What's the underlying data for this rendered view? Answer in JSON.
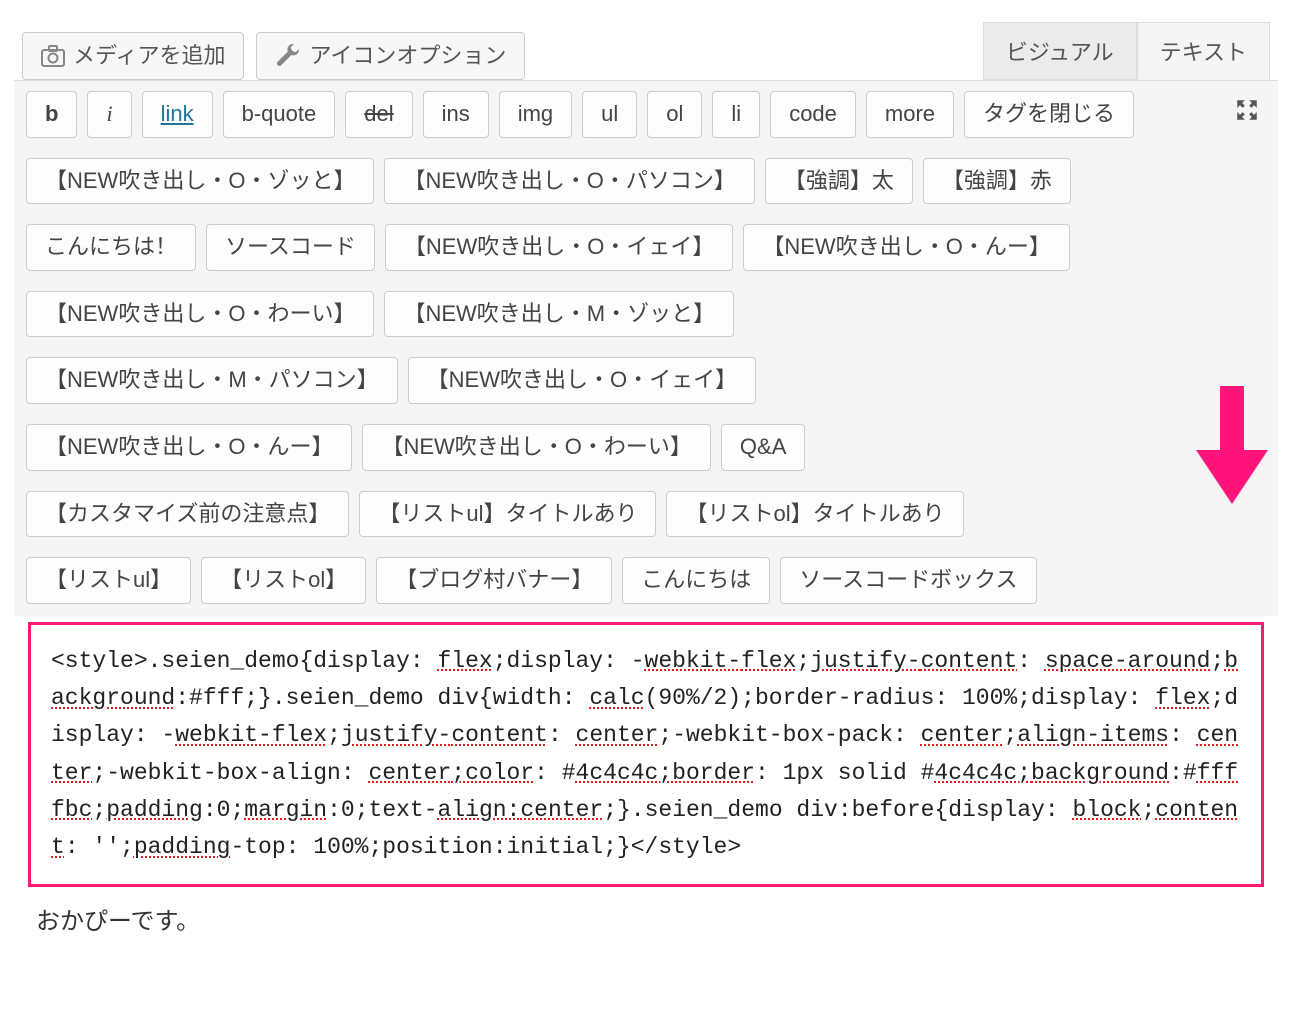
{
  "topButtons": {
    "addMedia": "メディアを追加",
    "iconOptions": "アイコンオプション"
  },
  "tabs": {
    "visual": "ビジュアル",
    "text": "テキスト"
  },
  "quicktags": {
    "b": "b",
    "i": "i",
    "link": "link",
    "bquote": "b-quote",
    "del": "del",
    "ins": "ins",
    "img": "img",
    "ul": "ul",
    "ol": "ol",
    "li": "li",
    "code": "code",
    "more": "more",
    "close": "タグを閉じる"
  },
  "customTags": {
    "r1a": "【NEW吹き出し・O・ゾッと】",
    "r1b": "【NEW吹き出し・O・パソコン】",
    "r1c": "【強調】太",
    "r1d": "【強調】赤",
    "r2a": "こんにちは！",
    "r2b": "ソースコード",
    "r2c": "【NEW吹き出し・O・イェイ】",
    "r2d": "【NEW吹き出し・O・んー】",
    "r3a": "【NEW吹き出し・O・わーい】",
    "r3b": "【NEW吹き出し・M・ゾッと】",
    "r4a": "【NEW吹き出し・M・パソコン】",
    "r4b": "【NEW吹き出し・O・イェイ】",
    "r5a": "【NEW吹き出し・O・んー】",
    "r5b": "【NEW吹き出し・O・わーい】",
    "r5c": "Q&A",
    "r6a": "【カスタマイズ前の注意点】",
    "r6b": "【リストul】タイトルあり",
    "r6c": "【リストol】タイトルあり",
    "r7a": "【リストul】",
    "r7b": "【リストol】",
    "r7c": "【ブログ村バナー】",
    "r7d": "こんにちは",
    "r7e": "ソースコードボックス"
  },
  "codeContent": {
    "line": "<style>.seien_demo{display: flex;display: -webkit-flex;justify-content: space-around;background:#fff;}.seien_demo div{width: calc(90%/2);border-radius: 100%;display: flex;display: -webkit-flex;justify-content: center;-webkit-box-pack: center;align-items: center;-webkit-box-align: center;color: #4c4c4c;border: 1px solid #4c4c4c;background:#ffffbc;padding:0;margin:0;text-align:center;}.seien_demo div:before{display: block;content: '';padding-top: 100%;position:initial;}</style>"
  },
  "footerText": "おかぴーです。",
  "colors": {
    "highlightBorder": "#ff1a75",
    "arrow": "#ff1a75"
  }
}
